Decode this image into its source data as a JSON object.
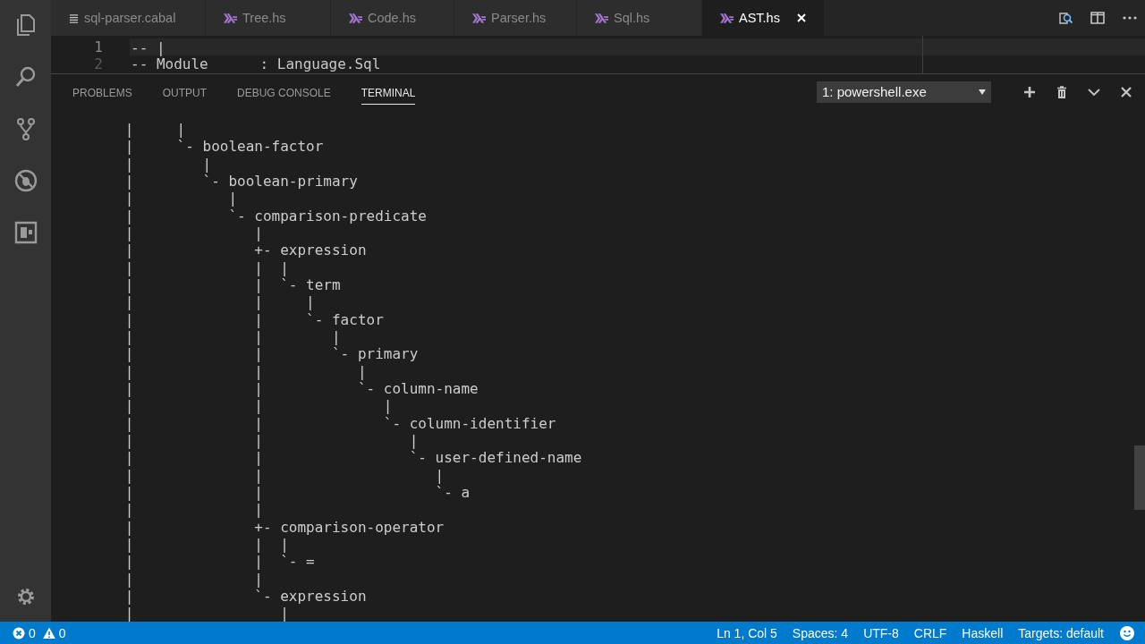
{
  "tabs": [
    {
      "label": "sql-parser.cabal",
      "kind": "config",
      "selected": false
    },
    {
      "label": "Tree.hs",
      "kind": "haskell",
      "selected": false
    },
    {
      "label": "Code.hs",
      "kind": "haskell",
      "selected": false
    },
    {
      "label": "Parser.hs",
      "kind": "haskell",
      "selected": false
    },
    {
      "label": "Sql.hs",
      "kind": "haskell",
      "selected": false
    },
    {
      "label": "AST.hs",
      "kind": "haskell",
      "selected": true
    }
  ],
  "editor_lines": [
    {
      "number": "1",
      "text": "-- |",
      "current": true
    },
    {
      "number": "2",
      "text": "-- Module      : Language.Sql",
      "current": false
    }
  ],
  "panel_tabs": [
    {
      "label": "PROBLEMS",
      "selected": false
    },
    {
      "label": "OUTPUT",
      "selected": false
    },
    {
      "label": "DEBUG CONSOLE",
      "selected": false
    },
    {
      "label": "TERMINAL",
      "selected": true
    }
  ],
  "terminal_selector": "1: powershell.exe",
  "terminal_lines": [
    "      |     |",
    "      |     `- boolean-factor",
    "      |        |",
    "      |        `- boolean-primary",
    "      |           |",
    "      |           `- comparison-predicate",
    "      |              |",
    "      |              +- expression",
    "      |              |  |",
    "      |              |  `- term",
    "      |              |     |",
    "      |              |     `- factor",
    "      |              |        |",
    "      |              |        `- primary",
    "      |              |           |",
    "      |              |           `- column-name",
    "      |              |              |",
    "      |              |              `- column-identifier",
    "      |              |                 |",
    "      |              |                 `- user-defined-name",
    "      |              |                    |",
    "      |              |                    `- a",
    "      |              |",
    "      |              +- comparison-operator",
    "      |              |  |",
    "      |              |  `- =",
    "      |              |",
    "      |              `- expression",
    "      |                 |"
  ],
  "status_bar": {
    "errors": "0",
    "warnings": "0",
    "items": [
      "Ln 1, Col 5",
      "Spaces: 4",
      "UTF-8",
      "CRLF",
      "Haskell",
      "Targets: default"
    ]
  }
}
